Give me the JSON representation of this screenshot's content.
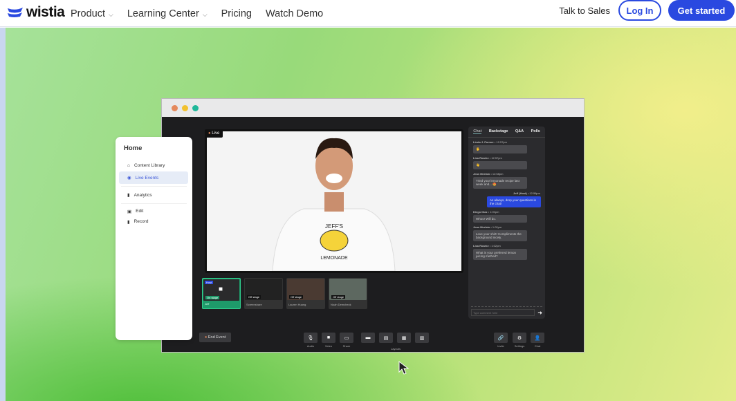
{
  "nav": {
    "logo": "wistia",
    "items": [
      {
        "label": "Product",
        "dropdown": true
      },
      {
        "label": "Learning Center",
        "dropdown": true
      },
      {
        "label": "Pricing"
      },
      {
        "label": "Watch Demo"
      }
    ],
    "talk_to_sales": "Talk to Sales",
    "login": "Log In",
    "get_started": "Get started",
    "accent": "#2a49e0"
  },
  "sidebar": {
    "title": "Home",
    "items": [
      {
        "label": "Content Library",
        "icon": "home-icon"
      },
      {
        "label": "Live Events",
        "icon": "broadcast-icon",
        "active": true
      },
      {
        "label": "Analytics",
        "icon": "bar-chart-icon"
      },
      {
        "label": "Edit",
        "icon": "edit-icon"
      },
      {
        "label": "Record",
        "icon": "record-icon"
      }
    ]
  },
  "stage": {
    "live_label": "Live",
    "shirt_text": "JEFF'S LEMONADE"
  },
  "chat": {
    "tabs": [
      "Chat",
      "Backstage",
      "Q&A",
      "Polls"
    ],
    "messages": [
      {
        "who": "Linda J. Farmer",
        "time": "12:57pm",
        "text": "🖐"
      },
      {
        "who": "Lisa Roarke",
        "time": "12:57pm",
        "text": "👋"
      },
      {
        "who": "Jean Merlain",
        "time": "12:58pm",
        "text": "Tried your lemonade recipe last week and... 🤩"
      },
      {
        "who": "Jeff (Host)",
        "time": "12:58pm",
        "text": "As always, drop your questions in the chat!",
        "me": true
      },
      {
        "who": "Diego Diaz",
        "time": "1:00pm",
        "text": "Whoo! Will do."
      },
      {
        "who": "Jean Merlain",
        "time": "1:02pm",
        "text": "Love your shirt! Compliments the background nicely."
      },
      {
        "who": "Lisa Roarke",
        "time": "1:02pm",
        "text": "What is your preferred lemon juicing method?"
      }
    ],
    "placeholder": "Type comment here"
  },
  "participants": [
    {
      "name": "Jeff",
      "status": "On stage",
      "badge": "Host"
    },
    {
      "name": "Screenshare",
      "status": "Off stage"
    },
    {
      "name": "Lauren Huang",
      "status": "Off stage"
    },
    {
      "name": "Noah Demcheck",
      "status": "Off stage"
    }
  ],
  "controls": {
    "end_event": "End Event",
    "audio": "Audio",
    "video": "Video",
    "share": "Share",
    "layouts": "Layouts",
    "invite": "Invite",
    "settings": "Settings",
    "chat": "Chat"
  }
}
